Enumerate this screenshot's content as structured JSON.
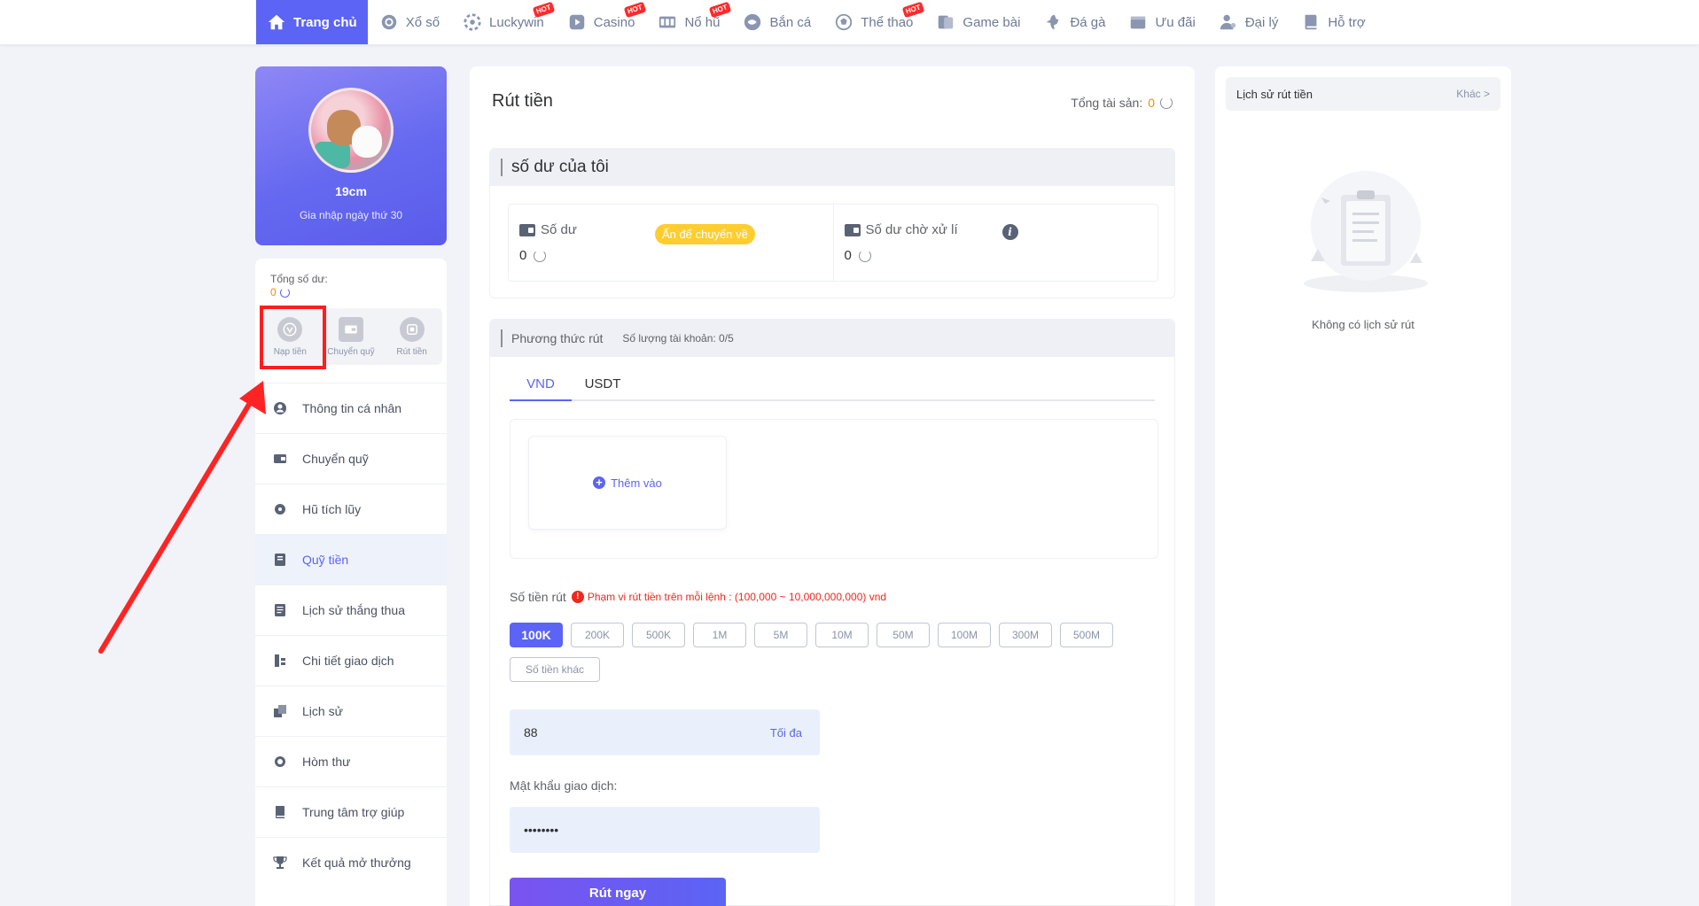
{
  "nav": {
    "items": [
      {
        "label": "Trang chủ",
        "icon": "home-icon",
        "active": true,
        "hot": false
      },
      {
        "label": "Xổ số",
        "icon": "lottery-icon",
        "active": false,
        "hot": false
      },
      {
        "label": "Luckywin",
        "icon": "luckywin-icon",
        "active": false,
        "hot": true
      },
      {
        "label": "Casino",
        "icon": "casino-icon",
        "active": false,
        "hot": true
      },
      {
        "label": "Nổ hũ",
        "icon": "slot-icon",
        "active": false,
        "hot": true
      },
      {
        "label": "Bắn cá",
        "icon": "fish-icon",
        "active": false,
        "hot": false
      },
      {
        "label": "Thể thao",
        "icon": "soccer-icon",
        "active": false,
        "hot": true
      },
      {
        "label": "Game bài",
        "icon": "cards-icon",
        "active": false,
        "hot": false
      },
      {
        "label": "Đá gà",
        "icon": "rooster-icon",
        "active": false,
        "hot": false
      },
      {
        "label": "Ưu đãi",
        "icon": "gift-icon",
        "active": false,
        "hot": false
      },
      {
        "label": "Đại lý",
        "icon": "agent-icon",
        "active": false,
        "hot": false
      },
      {
        "label": "Hỗ trợ",
        "icon": "support-icon",
        "active": false,
        "hot": false
      }
    ],
    "hot_label": "HOT"
  },
  "profile": {
    "username": "19cm",
    "joined": "Gia nhập ngày thứ 30"
  },
  "wallet": {
    "total_label": "Tổng số dư:",
    "total_value": "0",
    "quick_actions": [
      {
        "label": "Nạp tiền",
        "icon": "deposit-icon"
      },
      {
        "label": "Chuyển quỹ",
        "icon": "transfer-icon"
      },
      {
        "label": "Rút tiền",
        "icon": "withdraw-icon"
      }
    ]
  },
  "menu": {
    "items": [
      {
        "label": "Thông tin cá nhân",
        "icon": "user-icon",
        "active": false
      },
      {
        "label": "Chuyển quỹ",
        "icon": "wallet-icon",
        "active": false
      },
      {
        "label": "Hũ tích lũy",
        "icon": "jar-icon",
        "active": false
      },
      {
        "label": "Quỹ tiền",
        "icon": "fund-icon",
        "active": true
      },
      {
        "label": "Lịch sử thắng thua",
        "icon": "history-winloss-icon",
        "active": false
      },
      {
        "label": "Chi tiết giao dịch",
        "icon": "transaction-icon",
        "active": false
      },
      {
        "label": "Lịch sử",
        "icon": "history-icon",
        "active": false
      },
      {
        "label": "Hòm thư",
        "icon": "mailbox-icon",
        "active": false
      },
      {
        "label": "Trung tâm trợ giúp",
        "icon": "help-book-icon",
        "active": false
      },
      {
        "label": "Kết quả mở thưởng",
        "icon": "trophy-icon",
        "active": false
      }
    ]
  },
  "main": {
    "title": "Rút tiền",
    "assets_label": "Tổng tài sản:",
    "assets_value": "0",
    "balance_section": {
      "title": "số dư của tôi",
      "balance_label": "Số dư",
      "balance_value": "0",
      "badge": "Ấn để chuyển về",
      "pending_label": "Số dư chờ xử lí",
      "pending_value": "0"
    },
    "method_section": {
      "title": "Phương thức rút",
      "accounts": "Số lượng tài khoản: 0/5",
      "tabs": [
        "VND",
        "USDT"
      ],
      "add_label": "Thêm vào"
    },
    "amount": {
      "label": "Số tiền rút",
      "hint": "Phạm vi rút tiền trên mỗi lệnh : (100,000 ~ 10,000,000,000) vnd",
      "chips": [
        "100K",
        "200K",
        "500K",
        "1M",
        "5M",
        "10M",
        "50M",
        "100M",
        "300M",
        "500M"
      ],
      "other": "Số tiền khác",
      "value": "88",
      "max_label": "Tối đa"
    },
    "password": {
      "label": "Mật khẩu giao dịch:",
      "value": "••••••••"
    },
    "submit": "Rút ngay"
  },
  "history": {
    "title": "Lịch sử rút tiền",
    "more": "Khác >",
    "empty": "Không có lịch sử rút"
  },
  "colors": {
    "accent": "#5b64f4",
    "warning": "#ff8a00",
    "badge": "#ffcd2e",
    "danger": "#f2271c",
    "annotation": "#ff1e1e"
  }
}
